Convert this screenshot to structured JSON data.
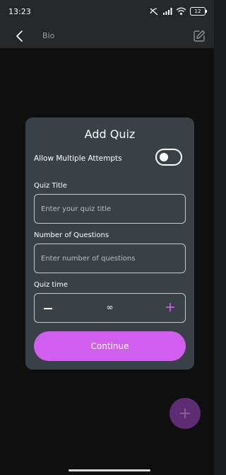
{
  "status_bar": {
    "time": "13:23",
    "battery": "12",
    "icons": [
      "signal-blocked-icon",
      "signal-icon",
      "wifi-icon",
      "battery-icon"
    ]
  },
  "header": {
    "title": "Bio",
    "back_icon": "chevron-left-icon",
    "edit_icon": "edit-icon"
  },
  "dialog": {
    "title": "Add Quiz",
    "allow_multiple": {
      "label": "Allow Multiple Attempts",
      "enabled": false
    },
    "quiz_title": {
      "label": "Quiz Title",
      "placeholder": "Enter your quiz title",
      "value": ""
    },
    "num_questions": {
      "label": "Number of Questions",
      "placeholder": "Enter number of questions",
      "value": ""
    },
    "quiz_time": {
      "label": "Quiz time",
      "minus": "–",
      "value": "∞",
      "plus_icon": "plus-icon"
    },
    "continue_label": "Continue"
  },
  "fab": {
    "icon": "plus-icon"
  },
  "colors": {
    "accent": "#d25ef0",
    "fab": "#5d2c73",
    "dialog_bg": "#3a4146",
    "app_bg": "#0f0f10",
    "bar_bg": "#262729"
  }
}
